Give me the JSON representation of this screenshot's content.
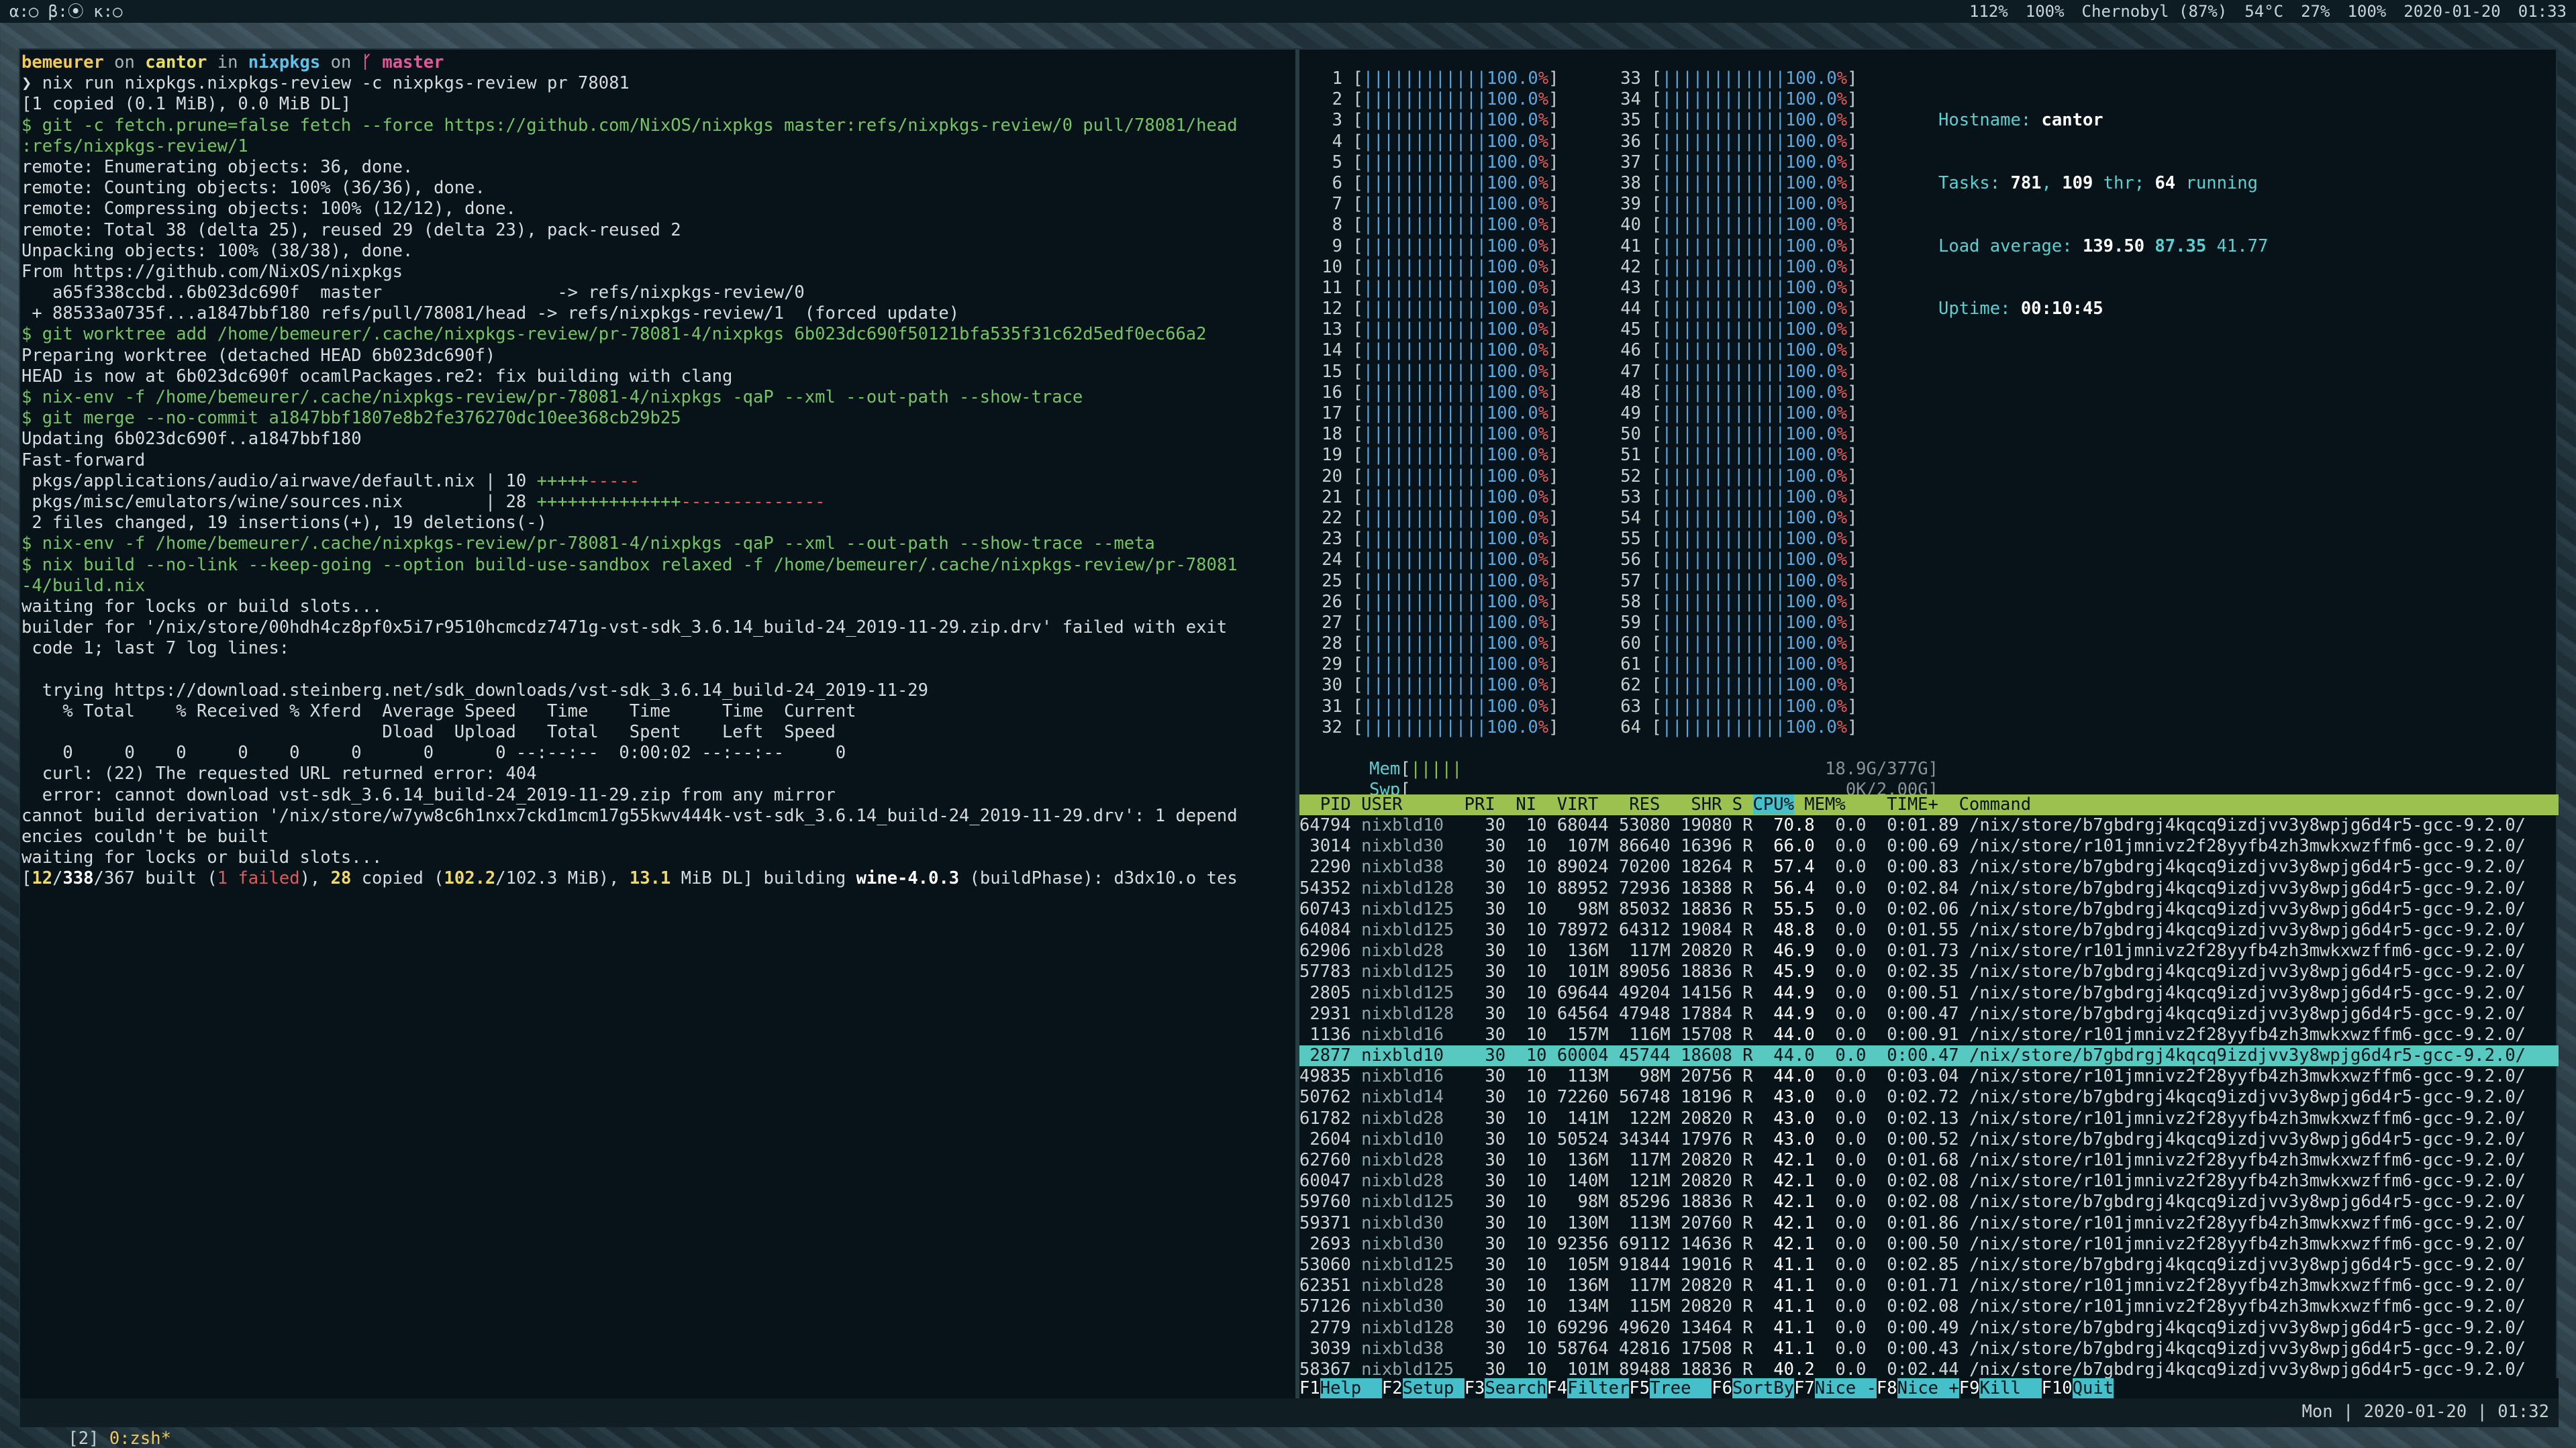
{
  "topbar": {
    "left": "α:○ β:⦿ κ:○",
    "items": [
      "112%",
      "100%",
      "Chernobyl (87%)",
      "54°C",
      "27%",
      "100%",
      "2020-01-20",
      "01:33"
    ]
  },
  "terminal": {
    "lines": [
      {
        "type": "prompt-head",
        "user": "bemeurer",
        "on1": " on ",
        "host": "cantor",
        "in": " in ",
        "dir": "nixpkgs",
        "on2": " on ",
        "branch": "ᚴ master"
      },
      {
        "text": "❯ nix run nixpkgs.nixpkgs-review -c nixpkgs-review pr 78081"
      },
      {
        "text": "[1 copied (0.1 MiB), 0.0 MiB DL]"
      },
      {
        "text": "$ git -c fetch.prune=false fetch --force https://github.com/NixOS/nixpkgs master:refs/nixpkgs-review/0 pull/78081/head",
        "cls": "green"
      },
      {
        "text": ":refs/nixpkgs-review/1",
        "cls": "green"
      },
      {
        "text": "remote: Enumerating objects: 36, done."
      },
      {
        "text": "remote: Counting objects: 100% (36/36), done."
      },
      {
        "text": "remote: Compressing objects: 100% (12/12), done."
      },
      {
        "text": "remote: Total 38 (delta 25), reused 29 (delta 23), pack-reused 2"
      },
      {
        "text": "Unpacking objects: 100% (38/38), done."
      },
      {
        "text": "From https://github.com/NixOS/nixpkgs"
      },
      {
        "text": "   a65f338ccbd..6b023dc690f  master                 -> refs/nixpkgs-review/0"
      },
      {
        "text": " + 88533a0735f...a1847bbf180 refs/pull/78081/head -> refs/nixpkgs-review/1  (forced update)"
      },
      {
        "text": "$ git worktree add /home/bemeurer/.cache/nixpkgs-review/pr-78081-4/nixpkgs 6b023dc690f50121bfa535f31c62d5edf0ec66a2",
        "cls": "green"
      },
      {
        "text": "Preparing worktree (detached HEAD 6b023dc690f)"
      },
      {
        "text": "HEAD is now at 6b023dc690f ocamlPackages.re2: fix building with clang"
      },
      {
        "text": "$ nix-env -f /home/bemeurer/.cache/nixpkgs-review/pr-78081-4/nixpkgs -qaP --xml --out-path --show-trace",
        "cls": "green"
      },
      {
        "text": "$ git merge --no-commit a1847bbf1807e8b2fe376270dc10ee368cb29b25",
        "cls": "green"
      },
      {
        "text": "Updating 6b023dc690f..a1847bbf180"
      },
      {
        "text": "Fast-forward"
      },
      {
        "type": "diff",
        "path": " pkgs/applications/audio/airwave/default.nix | 10 ",
        "plus": "+++++",
        "minus": "-----"
      },
      {
        "type": "diff",
        "path": " pkgs/misc/emulators/wine/sources.nix        | 28 ",
        "plus": "++++++++++++++",
        "minus": "--------------"
      },
      {
        "text": " 2 files changed, 19 insertions(+), 19 deletions(-)"
      },
      {
        "text": "$ nix-env -f /home/bemeurer/.cache/nixpkgs-review/pr-78081-4/nixpkgs -qaP --xml --out-path --show-trace --meta",
        "cls": "green"
      },
      {
        "text": "$ nix build --no-link --keep-going --option build-use-sandbox relaxed -f /home/bemeurer/.cache/nixpkgs-review/pr-78081",
        "cls": "green"
      },
      {
        "text": "-4/build.nix",
        "cls": "green"
      },
      {
        "text": "waiting for locks or build slots..."
      },
      {
        "text": "builder for '/nix/store/00hdh4cz8pf0x5i7r9510hcmcdz7471g-vst-sdk_3.6.14_build-24_2019-11-29.zip.drv' failed with exit"
      },
      {
        "text": " code 1; last 7 log lines:"
      },
      {
        "text": ""
      },
      {
        "text": "  trying https://download.steinberg.net/sdk_downloads/vst-sdk_3.6.14_build-24_2019-11-29"
      },
      {
        "text": "    % Total    % Received % Xferd  Average Speed   Time    Time     Time  Current"
      },
      {
        "text": "                                   Dload  Upload   Total   Spent    Left  Speed"
      },
      {
        "text": "    0     0    0     0    0     0      0      0 --:--:--  0:00:02 --:--:--     0"
      },
      {
        "text": "  curl: (22) The requested URL returned error: 404"
      },
      {
        "text": "  error: cannot download vst-sdk_3.6.14_build-24_2019-11-29.zip from any mirror"
      },
      {
        "text": "cannot build derivation '/nix/store/w7yw8c6h1nxx7ckd1mcm17g55kwv444k-vst-sdk_3.6.14_build-24_2019-11-29.drv': 1 depend"
      },
      {
        "text": "encies couldn't be built"
      },
      {
        "text": "waiting for locks or build slots..."
      },
      {
        "type": "progress",
        "a": "[",
        "b": "12",
        "c": "/",
        "d": "338",
        "e": "/367 built (",
        "f": "1 failed",
        "g": "), ",
        "h": "28",
        "i": " copied (",
        "j": "102.2",
        "k": "/102.3 MiB), ",
        "l": "13.1",
        "m": " MiB DL] building ",
        "n": "wine-4.0.3",
        "o": " (buildPhase): d3dx10.o tes"
      }
    ]
  },
  "htop": {
    "cpus_left": [
      "1",
      "2",
      "3",
      "4",
      "5",
      "6",
      "7",
      "8",
      "9",
      "10",
      "11",
      "12",
      "13",
      "14",
      "15",
      "16",
      "17",
      "18",
      "19",
      "20",
      "21",
      "22",
      "23",
      "24",
      "25",
      "26",
      "27",
      "28",
      "29",
      "30",
      "31",
      "32"
    ],
    "cpus_right": [
      "33",
      "34",
      "35",
      "36",
      "37",
      "38",
      "39",
      "40",
      "41",
      "42",
      "43",
      "44",
      "45",
      "46",
      "47",
      "48",
      "49",
      "50",
      "51",
      "52",
      "53",
      "54",
      "55",
      "56",
      "57",
      "58",
      "59",
      "60",
      "61",
      "62",
      "63",
      "64"
    ],
    "cpu_bar": "||||||||||||",
    "cpu_pct": "100.0%",
    "mem": {
      "label": "Mem",
      "bar": "|||||",
      "value": "18.9G/377G"
    },
    "swp": {
      "label": "Swp",
      "bar": "",
      "value": "0K/2.00G"
    },
    "info": {
      "hostname_label": "Hostname: ",
      "hostname": "cantor",
      "tasks_label": "Tasks: ",
      "tasks": "781",
      "tasks_sep": ", ",
      "thr": "109",
      "thr_label": " thr; ",
      "running": "64",
      "running_label": " running",
      "load_label": "Load average: ",
      "load1": "139.50",
      "load5": "87.35",
      "load15": "41.77",
      "uptime_label": "Uptime: ",
      "uptime": "00:10:45"
    },
    "header": {
      "pre": "  PID USER      PRI  NI  VIRT   RES   SHR S ",
      "sort": "CPU%",
      "post": " MEM%    TIME+  Command"
    },
    "selected_index": 11,
    "rows": [
      [
        "64794",
        "nixbld10",
        "30",
        "10",
        "68044",
        "53080",
        "19080",
        "R",
        "70.8",
        "0.0",
        "0:01.89",
        "/nix/store/b7gbdrgj4kqcq9izdjvv3y8wpjg6d4r5-gcc-9.2.0/"
      ],
      [
        "3014",
        "nixbld30",
        "30",
        "10",
        "107M",
        "86640",
        "16396",
        "R",
        "66.0",
        "0.0",
        "0:00.69",
        "/nix/store/r101jmnivz2f28yyfb4zh3mwkxwzffm6-gcc-9.2.0/"
      ],
      [
        "2290",
        "nixbld38",
        "30",
        "10",
        "89024",
        "70200",
        "18264",
        "R",
        "57.4",
        "0.0",
        "0:00.83",
        "/nix/store/b7gbdrgj4kqcq9izdjvv3y8wpjg6d4r5-gcc-9.2.0/"
      ],
      [
        "54352",
        "nixbld128",
        "30",
        "10",
        "88952",
        "72936",
        "18388",
        "R",
        "56.4",
        "0.0",
        "0:02.84",
        "/nix/store/b7gbdrgj4kqcq9izdjvv3y8wpjg6d4r5-gcc-9.2.0/"
      ],
      [
        "60743",
        "nixbld125",
        "30",
        "10",
        "98M",
        "85032",
        "18836",
        "R",
        "55.5",
        "0.0",
        "0:02.06",
        "/nix/store/b7gbdrgj4kqcq9izdjvv3y8wpjg6d4r5-gcc-9.2.0/"
      ],
      [
        "64084",
        "nixbld125",
        "30",
        "10",
        "78972",
        "64312",
        "19084",
        "R",
        "48.8",
        "0.0",
        "0:01.55",
        "/nix/store/b7gbdrgj4kqcq9izdjvv3y8wpjg6d4r5-gcc-9.2.0/"
      ],
      [
        "62906",
        "nixbld28",
        "30",
        "10",
        "136M",
        "117M",
        "20820",
        "R",
        "46.9",
        "0.0",
        "0:01.73",
        "/nix/store/r101jmnivz2f28yyfb4zh3mwkxwzffm6-gcc-9.2.0/"
      ],
      [
        "57783",
        "nixbld125",
        "30",
        "10",
        "101M",
        "89056",
        "18836",
        "R",
        "45.9",
        "0.0",
        "0:02.35",
        "/nix/store/b7gbdrgj4kqcq9izdjvv3y8wpjg6d4r5-gcc-9.2.0/"
      ],
      [
        "2805",
        "nixbld125",
        "30",
        "10",
        "69644",
        "49204",
        "14156",
        "R",
        "44.9",
        "0.0",
        "0:00.51",
        "/nix/store/b7gbdrgj4kqcq9izdjvv3y8wpjg6d4r5-gcc-9.2.0/"
      ],
      [
        "2931",
        "nixbld128",
        "30",
        "10",
        "64564",
        "47948",
        "17884",
        "R",
        "44.9",
        "0.0",
        "0:00.47",
        "/nix/store/b7gbdrgj4kqcq9izdjvv3y8wpjg6d4r5-gcc-9.2.0/"
      ],
      [
        "1136",
        "nixbld16",
        "30",
        "10",
        "157M",
        "116M",
        "15708",
        "R",
        "44.0",
        "0.0",
        "0:00.91",
        "/nix/store/r101jmnivz2f28yyfb4zh3mwkxwzffm6-gcc-9.2.0/"
      ],
      [
        "2877",
        "nixbld10",
        "30",
        "10",
        "60004",
        "45744",
        "18608",
        "R",
        "44.0",
        "0.0",
        "0:00.47",
        "/nix/store/b7gbdrgj4kqcq9izdjvv3y8wpjg6d4r5-gcc-9.2.0/"
      ],
      [
        "49835",
        "nixbld16",
        "30",
        "10",
        "113M",
        "98M",
        "20756",
        "R",
        "44.0",
        "0.0",
        "0:03.04",
        "/nix/store/r101jmnivz2f28yyfb4zh3mwkxwzffm6-gcc-9.2.0/"
      ],
      [
        "50762",
        "nixbld14",
        "30",
        "10",
        "72260",
        "56748",
        "18196",
        "R",
        "43.0",
        "0.0",
        "0:02.72",
        "/nix/store/b7gbdrgj4kqcq9izdjvv3y8wpjg6d4r5-gcc-9.2.0/"
      ],
      [
        "61782",
        "nixbld28",
        "30",
        "10",
        "141M",
        "122M",
        "20820",
        "R",
        "43.0",
        "0.0",
        "0:02.13",
        "/nix/store/r101jmnivz2f28yyfb4zh3mwkxwzffm6-gcc-9.2.0/"
      ],
      [
        "2604",
        "nixbld10",
        "30",
        "10",
        "50524",
        "34344",
        "17976",
        "R",
        "43.0",
        "0.0",
        "0:00.52",
        "/nix/store/b7gbdrgj4kqcq9izdjvv3y8wpjg6d4r5-gcc-9.2.0/"
      ],
      [
        "62760",
        "nixbld28",
        "30",
        "10",
        "136M",
        "117M",
        "20820",
        "R",
        "42.1",
        "0.0",
        "0:01.68",
        "/nix/store/r101jmnivz2f28yyfb4zh3mwkxwzffm6-gcc-9.2.0/"
      ],
      [
        "60047",
        "nixbld28",
        "30",
        "10",
        "140M",
        "121M",
        "20820",
        "R",
        "42.1",
        "0.0",
        "0:02.08",
        "/nix/store/r101jmnivz2f28yyfb4zh3mwkxwzffm6-gcc-9.2.0/"
      ],
      [
        "59760",
        "nixbld125",
        "30",
        "10",
        "98M",
        "85296",
        "18836",
        "R",
        "42.1",
        "0.0",
        "0:02.08",
        "/nix/store/b7gbdrgj4kqcq9izdjvv3y8wpjg6d4r5-gcc-9.2.0/"
      ],
      [
        "59371",
        "nixbld30",
        "30",
        "10",
        "130M",
        "113M",
        "20760",
        "R",
        "42.1",
        "0.0",
        "0:01.86",
        "/nix/store/r101jmnivz2f28yyfb4zh3mwkxwzffm6-gcc-9.2.0/"
      ],
      [
        "2693",
        "nixbld30",
        "30",
        "10",
        "92356",
        "69112",
        "14636",
        "R",
        "42.1",
        "0.0",
        "0:00.50",
        "/nix/store/r101jmnivz2f28yyfb4zh3mwkxwzffm6-gcc-9.2.0/"
      ],
      [
        "53060",
        "nixbld125",
        "30",
        "10",
        "105M",
        "91844",
        "19016",
        "R",
        "41.1",
        "0.0",
        "0:02.85",
        "/nix/store/b7gbdrgj4kqcq9izdjvv3y8wpjg6d4r5-gcc-9.2.0/"
      ],
      [
        "62351",
        "nixbld28",
        "30",
        "10",
        "136M",
        "117M",
        "20820",
        "R",
        "41.1",
        "0.0",
        "0:01.71",
        "/nix/store/r101jmnivz2f28yyfb4zh3mwkxwzffm6-gcc-9.2.0/"
      ],
      [
        "57126",
        "nixbld30",
        "30",
        "10",
        "134M",
        "115M",
        "20820",
        "R",
        "41.1",
        "0.0",
        "0:02.08",
        "/nix/store/r101jmnivz2f28yyfb4zh3mwkxwzffm6-gcc-9.2.0/"
      ],
      [
        "2779",
        "nixbld128",
        "30",
        "10",
        "69296",
        "49620",
        "13464",
        "R",
        "41.1",
        "0.0",
        "0:00.49",
        "/nix/store/b7gbdrgj4kqcq9izdjvv3y8wpjg6d4r5-gcc-9.2.0/"
      ],
      [
        "3039",
        "nixbld38",
        "30",
        "10",
        "58764",
        "42816",
        "17508",
        "R",
        "41.1",
        "0.0",
        "0:00.43",
        "/nix/store/b7gbdrgj4kqcq9izdjvv3y8wpjg6d4r5-gcc-9.2.0/"
      ],
      [
        "58367",
        "nixbld125",
        "30",
        "10",
        "101M",
        "89488",
        "18836",
        "R",
        "40.2",
        "0.0",
        "0:02.44",
        "/nix/store/b7gbdrgj4kqcq9izdjvv3y8wpjg6d4r5-gcc-9.2.0/"
      ]
    ],
    "fkeys": [
      {
        "k": "F1",
        "l": "Help  "
      },
      {
        "k": "F2",
        "l": "Setup "
      },
      {
        "k": "F3",
        "l": "Search"
      },
      {
        "k": "F4",
        "l": "Filter"
      },
      {
        "k": "F5",
        "l": "Tree  "
      },
      {
        "k": "F6",
        "l": "SortBy"
      },
      {
        "k": "F7",
        "l": "Nice -"
      },
      {
        "k": "F8",
        "l": "Nice +"
      },
      {
        "k": "F9",
        "l": "Kill  "
      },
      {
        "k": "F10",
        "l": "Quit"
      }
    ]
  },
  "tmux": {
    "session": "[2] ",
    "window": "0:zsh*",
    "right": "Mon | 2020-01-20 | 01:32"
  }
}
